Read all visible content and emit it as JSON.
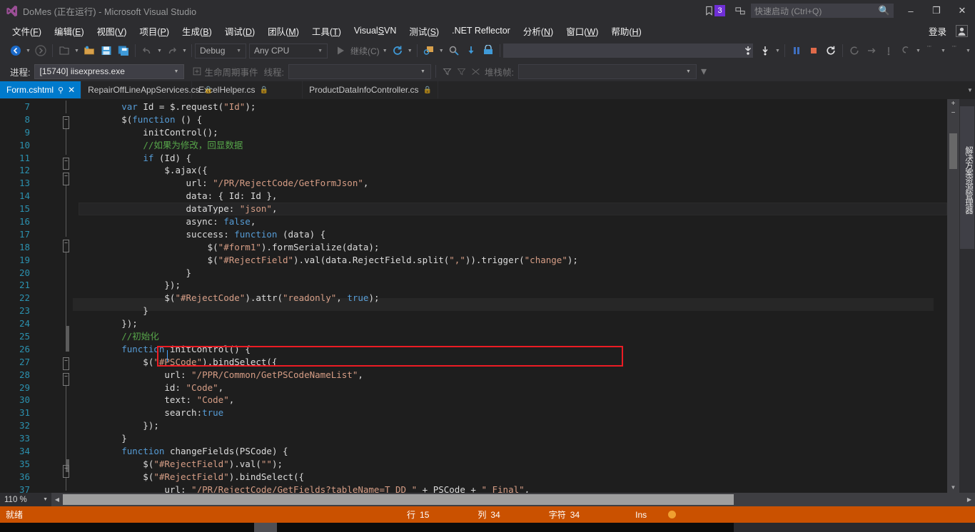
{
  "window": {
    "title": "DoMes (正在运行) - Microsoft Visual Studio",
    "minimize": "–",
    "maximize": "❐",
    "close": "✕",
    "notification_count": "3",
    "quick_launch_placeholder": "快速启动 (Ctrl+Q)",
    "search_icon": "search-icon"
  },
  "menu": {
    "items": [
      {
        "pre": "文件(",
        "key": "F",
        "post": ")"
      },
      {
        "pre": "编辑(",
        "key": "E",
        "post": ")"
      },
      {
        "pre": "视图(",
        "key": "V",
        "post": ")"
      },
      {
        "pre": "项目(",
        "key": "P",
        "post": ")"
      },
      {
        "pre": "生成(",
        "key": "B",
        "post": ")"
      },
      {
        "pre": "调试(",
        "key": "D",
        "post": ")"
      },
      {
        "pre": "团队(",
        "key": "M",
        "post": ")"
      },
      {
        "pre": "工具(",
        "key": "T",
        "post": ")"
      },
      {
        "pre": "Visual",
        "key": "S",
        "post": "VN"
      },
      {
        "pre": "测试(",
        "key": "S",
        "post": ")"
      },
      {
        "pre": ".NET Reflector",
        "key": "",
        "post": ""
      },
      {
        "pre": "分析(",
        "key": "N",
        "post": ")"
      },
      {
        "pre": "窗口(",
        "key": "W",
        "post": ")"
      },
      {
        "pre": "帮助(",
        "key": "H",
        "post": ")"
      }
    ],
    "signin_label": "登录"
  },
  "toolbar": {
    "navigate_back": "navigate-back-icon",
    "navigate_forward": "navigate-forward-icon",
    "new_project": "new-project-icon",
    "open_file": "open-file-icon",
    "save": "save-icon",
    "save_all": "save-all-icon",
    "undo": "undo-icon",
    "redo": "redo-icon",
    "config_value": "Debug",
    "platform_value": "Any CPU",
    "continue_label": "继续(C)",
    "restart_label": "restart-icon",
    "attach_label": "attach-to-process-icon",
    "pause_label": "pause-icon",
    "stop_label": "stop-icon",
    "hot_reload": "hot-reload-icon"
  },
  "debugbar": {
    "process_label": "进程:",
    "process_value": "[15740] iisexpress.exe",
    "lifecycle_label": "生命周期事件",
    "thread_label": "线程:",
    "thread_value": "",
    "stackframe_label": "堆栈帧:",
    "stackframe_value": ""
  },
  "tabs": [
    {
      "label": "Form.cshtml",
      "active": true,
      "pinned": true,
      "closable": true
    },
    {
      "label": "RepairOffLineAppServices.cs",
      "active": false,
      "locked": true
    },
    {
      "label": "ExcelHelper.cs",
      "active": false,
      "locked": true
    },
    {
      "label": "ProductDataInfoController.cs",
      "active": false,
      "locked": true
    }
  ],
  "editor": {
    "zoom_level": "110 %",
    "first_line_number": 7,
    "current_line_index": 8,
    "lines": [
      {
        "n": 7,
        "fold": "line",
        "html": "        <span class='kw'>var</span> Id = $.request(<span class='str'>\"Id\"</span>);"
      },
      {
        "n": 8,
        "fold": "minus",
        "html": "        $(<span class='kw'>function</span> () {"
      },
      {
        "n": 9,
        "fold": "line",
        "html": "            initControl();"
      },
      {
        "n": 10,
        "fold": "line",
        "html": "            <span class='cmt'>//如果为修改，回显数据</span>"
      },
      {
        "n": 11,
        "fold": "minus",
        "html": "            <span class='kw'>if</span> (Id) {"
      },
      {
        "n": 12,
        "fold": "minus",
        "html": "                $.ajax({"
      },
      {
        "n": 13,
        "fold": "line",
        "html": "                    url: <span class='str'>\"/PR/RejectCode/GetFormJson\"</span>,"
      },
      {
        "n": 14,
        "fold": "line",
        "html": "                    data: { Id: Id },"
      },
      {
        "n": 15,
        "fold": "line",
        "html": "                    dataType: <span class='str'>\"json\"</span>,"
      },
      {
        "n": 16,
        "fold": "line",
        "html": "                    async: <span class='kw'>false</span>,"
      },
      {
        "n": 17,
        "fold": "minus",
        "html": "                    success: <span class='kw'>function</span> (data) {"
      },
      {
        "n": 18,
        "fold": "line",
        "html": "                        $(<span class='str'>\"#form1\"</span>).formSerialize(data);"
      },
      {
        "n": 19,
        "fold": "line",
        "html": "                        $(<span class='str'>\"#RejectField\"</span>).val(data.RejectField.split(<span class='str'>\",\"</span>)).trigger(<span class='str'>\"change\"</span>);"
      },
      {
        "n": 20,
        "fold": "line",
        "html": "                    }"
      },
      {
        "n": 21,
        "fold": "line",
        "html": "                });"
      },
      {
        "n": 22,
        "fold": "line",
        "html": "                $(<span class='str'>\"#RejectCode\"</span>).attr(<span class='str'>\"readonly\"</span>, <span class='kw'>true</span>);"
      },
      {
        "n": 23,
        "fold": "end",
        "html": "            }"
      },
      {
        "n": 24,
        "fold": "end",
        "html": "        });"
      },
      {
        "n": 25,
        "fold": "none",
        "html": "        <span class='cmt'>//初始化</span>"
      },
      {
        "n": 26,
        "fold": "minus",
        "html": "        <span class='kw'>function</span> initControl() {"
      },
      {
        "n": 27,
        "fold": "minus",
        "html": "            $(<span class='str'>\"#PSCode\"</span>).bindSelect({"
      },
      {
        "n": 28,
        "fold": "line",
        "html": "                url: <span class='str'>\"/PPR/Common/GetPSCodeNameList\"</span>,"
      },
      {
        "n": 29,
        "fold": "line",
        "html": "                id: <span class='str'>\"Code\"</span>,"
      },
      {
        "n": 30,
        "fold": "line",
        "html": "                text: <span class='str'>\"Code\"</span>,"
      },
      {
        "n": 31,
        "fold": "line",
        "html": "                search:<span class='kw'>true</span>"
      },
      {
        "n": 32,
        "fold": "line",
        "html": "            });"
      },
      {
        "n": 33,
        "fold": "end",
        "html": "        }"
      },
      {
        "n": 34,
        "fold": "minus",
        "html": "        <span class='kw'>function</span> changeFields(PSCode) {"
      },
      {
        "n": 35,
        "fold": "line",
        "html": "            $(<span class='str'>\"#RejectField\"</span>).val(<span class='str'>\"\"</span>);"
      },
      {
        "n": 36,
        "fold": "minus",
        "html": "            $(<span class='str'>\"#RejectField\"</span>).bindSelect({"
      },
      {
        "n": 37,
        "fold": "line",
        "html": "                url: <span class='str'>\"/PR/RejectCode/GetFields?tableName=T_DD_\"</span> + PSCode + <span class='str'>\"_Final\"</span>,"
      }
    ]
  },
  "right_dock": {
    "solution_explorer_tab": "解决方案资源管理器"
  },
  "statusbar": {
    "ready": "就绪",
    "line_label": "行",
    "line_value": "15",
    "col_label": "列",
    "col_value": "34",
    "char_label": "字符",
    "char_value": "34",
    "insert_mode": "Ins"
  },
  "colors": {
    "accent_blue": "#007acc",
    "status_orange": "#ca5100",
    "highlight_red": "#ec1c24",
    "badge_purple": "#6f2fd6"
  }
}
